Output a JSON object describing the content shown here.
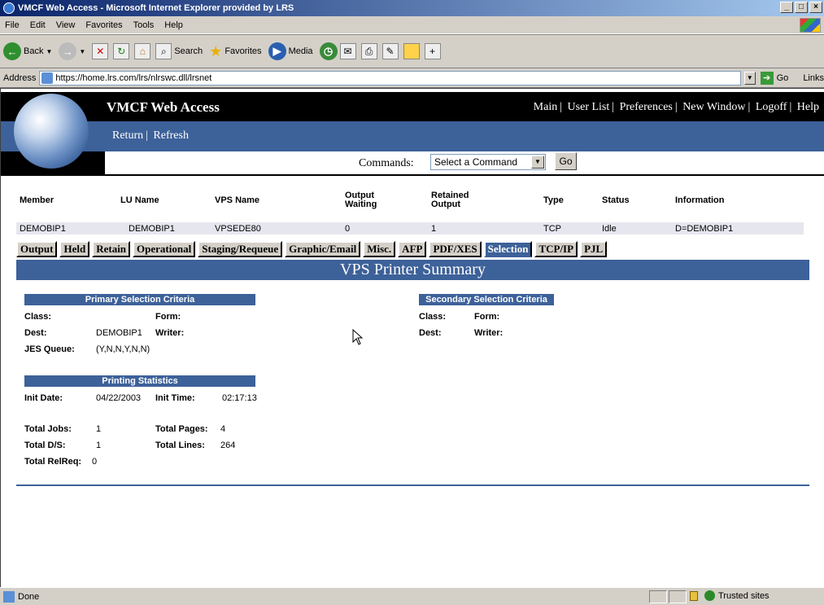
{
  "window": {
    "title": "VMCF Web Access - Microsoft Internet Explorer provided by LRS"
  },
  "menu": [
    "File",
    "Edit",
    "View",
    "Favorites",
    "Tools",
    "Help"
  ],
  "toolbar": {
    "back": "Back",
    "search": "Search",
    "favorites": "Favorites",
    "media": "Media"
  },
  "address": {
    "label": "Address",
    "url": "https://home.lrs.com/lrs/nlrswc.dll/lrsnet",
    "go": "Go",
    "links": "Links"
  },
  "app": {
    "title": "VMCF Web Access",
    "topnav": [
      "Main",
      "User List",
      "Preferences",
      "New Window",
      "Logoff",
      "Help"
    ],
    "subnav": [
      "Return",
      "Refresh"
    ],
    "commands_label": "Commands:",
    "command_select": "Select a Command",
    "go": "Go"
  },
  "info": {
    "headers": [
      "Member",
      "LU Name",
      "VPS Name",
      "Output Waiting",
      "Retained Output",
      "Type",
      "Status",
      "Information"
    ],
    "values": [
      "DEMOBIP1",
      "DEMOBIP1",
      "VPSEDE80",
      "0",
      "1",
      "TCP",
      "Idle",
      "D=DEMOBIP1"
    ]
  },
  "tabs": [
    "Output",
    "Held",
    "Retain",
    "Operational",
    "Staging/Requeue",
    "Graphic/Email",
    "Misc.",
    "AFP",
    "PDF/XES",
    "Selection",
    "TCP/IP",
    "PJL"
  ],
  "active_tab": "Selection",
  "summary_title": "VPS Printer Summary",
  "primary": {
    "title": "Primary Selection Criteria",
    "class_label": "Class:",
    "class_value": "",
    "form_label": "Form:",
    "form_value": "",
    "dest_label": "Dest:",
    "dest_value": "DEMOBIP1",
    "writer_label": "Writer:",
    "writer_value": "",
    "jes_label": "JES Queue:",
    "jes_value": "(Y,N,N,Y,N,N)"
  },
  "secondary": {
    "title": "Secondary Selection Criteria",
    "class_label": "Class:",
    "form_label": "Form:",
    "dest_label": "Dest:",
    "writer_label": "Writer:"
  },
  "stats": {
    "title": "Printing Statistics",
    "init_date_label": "Init Date:",
    "init_date": "04/22/2003",
    "init_time_label": "Init Time:",
    "init_time": "02:17:13",
    "total_jobs_label": "Total Jobs:",
    "total_jobs": "1",
    "total_pages_label": "Total Pages:",
    "total_pages": "4",
    "total_ds_label": "Total D/S:",
    "total_ds": "1",
    "total_lines_label": "Total Lines:",
    "total_lines": "264",
    "total_relreq_label": "Total RelReq:",
    "total_relreq": "0"
  },
  "status": {
    "text": "Done",
    "zone": "Trusted sites"
  },
  "colors": {
    "banner_blue": "#3d6199",
    "title_bar": "#0a246a"
  }
}
